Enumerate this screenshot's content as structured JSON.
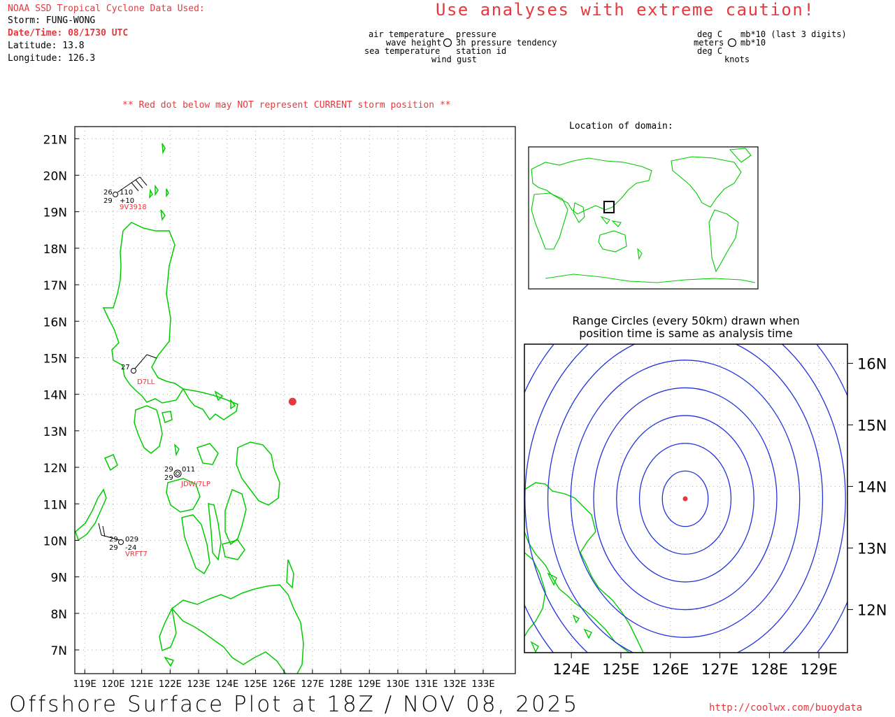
{
  "header": {
    "title": "NOAA SSD Tropical Cyclone Data Used:",
    "storm_line": "Storm: FUNG-WONG",
    "datetime_line": "Date/Time: 08/1730 UTC",
    "latitude_line": "Latitude: 13.8",
    "longitude_line": "Longitude: 126.3"
  },
  "caution": "Use analyses with extreme caution!",
  "legend": {
    "left": {
      "air_temperature": "air temperature",
      "wave_height": "wave height",
      "sea_temperature": "sea temperature",
      "pressure": "pressure",
      "pressure_tendency": "3h pressure tendency",
      "station_id": "station id",
      "wind_gust": "wind gust"
    },
    "right": {
      "deg_c_top": "deg C",
      "meters": "meters",
      "deg_c_bottom": "deg C",
      "mb_last3": "mb*10 (last 3 digits)",
      "mb10": "mb*10",
      "knots": "knots"
    }
  },
  "warning": "** Red dot below may NOT represent CURRENT storm position **",
  "main_map": {
    "lat_labels": [
      "21N",
      "20N",
      "19N",
      "18N",
      "17N",
      "16N",
      "15N",
      "14N",
      "13N",
      "12N",
      "11N",
      "10N",
      "9N",
      "8N",
      "7N"
    ],
    "lon_labels": [
      "119E",
      "120E",
      "121E",
      "122E",
      "123E",
      "124E",
      "125E",
      "126E",
      "127E",
      "128E",
      "129E",
      "130E",
      "131E",
      "132E",
      "133E"
    ],
    "storm_position": {
      "lat": 13.8,
      "lon": 126.3,
      "color": "#e8383d"
    },
    "land_color": "#00cc00",
    "grid_color": "#aaaaaa",
    "stations": [
      {
        "id": "9V3918",
        "air_temp": "26",
        "sea_temp": "29",
        "pressure": "110",
        "tendency": "+10"
      },
      {
        "id": "D7LL",
        "air_temp": "27",
        "sea_temp": "",
        "pressure": "",
        "tendency": ""
      },
      {
        "id": "JDW/7LP",
        "air_temp": "29",
        "sea_temp": "29",
        "pressure": "011",
        "tendency": ""
      },
      {
        "id": "VRFT7",
        "air_temp": "29",
        "sea_temp": "29",
        "pressure": "029",
        "tendency": "-24"
      }
    ]
  },
  "inset_world": {
    "title": "Location of domain:"
  },
  "range_map": {
    "title_line1": "Range Circles (every 50km) drawn when",
    "title_line2": "position time is same as analysis time",
    "lat_labels": [
      "16N",
      "15N",
      "14N",
      "13N",
      "12N"
    ],
    "lon_labels": [
      "124E",
      "125E",
      "126E",
      "127E",
      "128E",
      "129E"
    ],
    "circle_color": "#2233dd",
    "circle_interval_km": 50
  },
  "footer": {
    "title": "Offshore Surface Plot at 18Z / NOV 08, 2025",
    "url": "http://coolwx.com/buoydata"
  }
}
